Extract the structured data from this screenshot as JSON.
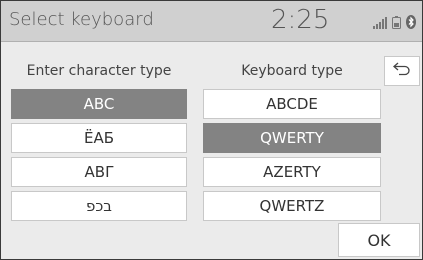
{
  "header": {
    "title": "Select keyboard",
    "clock": "2:25",
    "status_icons": [
      "signal-bars-icon",
      "phone-battery-icon",
      "bluetooth-icon"
    ]
  },
  "character_type": {
    "label": "Enter character type",
    "options": [
      "ABC",
      "ЁАБ",
      "ΑΒΓ",
      "בכפ"
    ],
    "selected": "ABC"
  },
  "keyboard_type": {
    "label": "Keyboard type",
    "options": [
      "ABCDE",
      "QWERTY",
      "AZERTY",
      "QWERTZ"
    ],
    "selected": "QWERTY"
  },
  "back_icon": "return-arrow-icon",
  "ok_label": "OK",
  "colors": {
    "selected_bg": "#838383",
    "header_bg": "#d0d0d0",
    "panel_bg": "#ebebeb"
  }
}
